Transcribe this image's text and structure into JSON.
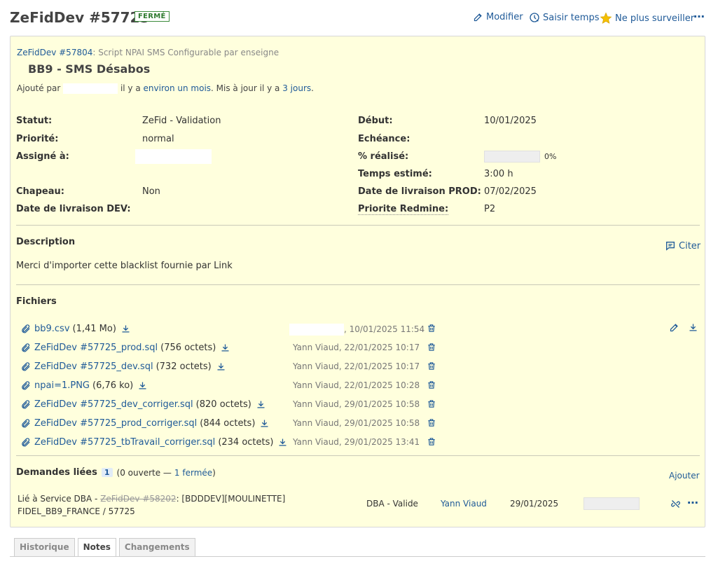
{
  "header": {
    "title": "ZeFidDev #57725",
    "status_badge": "FERMÉ",
    "actions": {
      "edit": "Modifier",
      "log_time": "Saisir temps",
      "unwatch": "Ne plus surveiller"
    }
  },
  "issue": {
    "parent_link": "ZeFidDev #57804",
    "parent_subject": ": Script NPAI SMS Configurable par enseigne",
    "subject": "BB9 - SMS Désabos",
    "author": {
      "prefix": "Ajouté par",
      "mid": "il y a",
      "added_ago": "environ un mois",
      "updated_text": ". Mis à jour il y a",
      "updated_ago": "3 jours",
      "end": "."
    },
    "attributes_left": [
      {
        "label": "Statut:",
        "value": "ZeFid - Validation"
      },
      {
        "label": "Priorité:",
        "value": "normal"
      },
      {
        "label": "Assigné à:",
        "value": ""
      },
      {
        "label": "Chapeau:",
        "value": "Non"
      },
      {
        "label": "Date de livraison DEV:",
        "value": ""
      }
    ],
    "attributes_right": [
      {
        "label": "Début:",
        "value": "10/01/2025"
      },
      {
        "label": "Echéance:",
        "value": ""
      },
      {
        "label": "% réalisé:",
        "value": "0%",
        "progress": 0
      },
      {
        "label": "Temps estimé:",
        "value": "3:00 h"
      },
      {
        "label": "Date de livraison PROD:",
        "value": "07/02/2025"
      },
      {
        "label": "Priorite Redmine:",
        "value": "P2"
      }
    ],
    "description": {
      "title": "Description",
      "quote": "Citer",
      "text": "Merci d'importer cette blacklist fournie par Link"
    },
    "files": {
      "title": "Fichiers",
      "items": [
        {
          "name": "bb9.csv",
          "size": "(1,41 Mo)",
          "author": "",
          "date": ", 10/01/2025 11:54"
        },
        {
          "name": "ZeFidDev #57725_prod.sql",
          "size": "(756 octets)",
          "author": "Yann Viaud",
          "date": ", 22/01/2025 10:17"
        },
        {
          "name": "ZeFidDev #57725_dev.sql",
          "size": "(732 octets)",
          "author": "Yann Viaud",
          "date": ", 22/01/2025 10:17"
        },
        {
          "name": "npai=1.PNG",
          "size": "(6,76 ko)",
          "author": "Yann Viaud",
          "date": ", 22/01/2025 10:28"
        },
        {
          "name": "ZeFidDev #57725_dev_corriger.sql",
          "size": "(820 octets)",
          "author": "Yann Viaud",
          "date": ", 29/01/2025 10:58"
        },
        {
          "name": "ZeFidDev #57725_prod_corriger.sql",
          "size": "(844 octets)",
          "author": "Yann Viaud",
          "date": ", 29/01/2025 10:58"
        },
        {
          "name": "ZeFidDev #57725_tbTravail_corriger.sql",
          "size": "(234 octets)",
          "author": "Yann Viaud",
          "date": ", 29/01/2025 13:41"
        }
      ]
    },
    "relations": {
      "title": "Demandes liées",
      "count": "1",
      "summary_open": "(0 ouverte —",
      "summary_closed": "1 fermée",
      "summary_end": ")",
      "add": "Ajouter",
      "items": [
        {
          "prefix": "Lié à Service DBA -",
          "issue": "ZeFidDev #58202",
          "subject": ": [BDDDEV][MOULINETTE]",
          "subject2": "FIDEL_BB9_FRANCE / 57725",
          "status": "DBA - Valide",
          "assignee": "Yann Viaud",
          "date": "29/01/2025"
        }
      ]
    }
  },
  "tabs": [
    "Historique",
    "Notes",
    "Changements"
  ],
  "selected_tab": "Notes",
  "colors": {
    "link": "#1f5a98",
    "issue_bg": "#ffffdd",
    "closed_badge": "#2f7a2f"
  },
  "icons": [
    "pencil-icon",
    "clock-icon",
    "star-icon",
    "ellipsis-icon",
    "quote-icon",
    "paperclip-icon",
    "download-icon",
    "trash-icon",
    "unlink-icon"
  ]
}
